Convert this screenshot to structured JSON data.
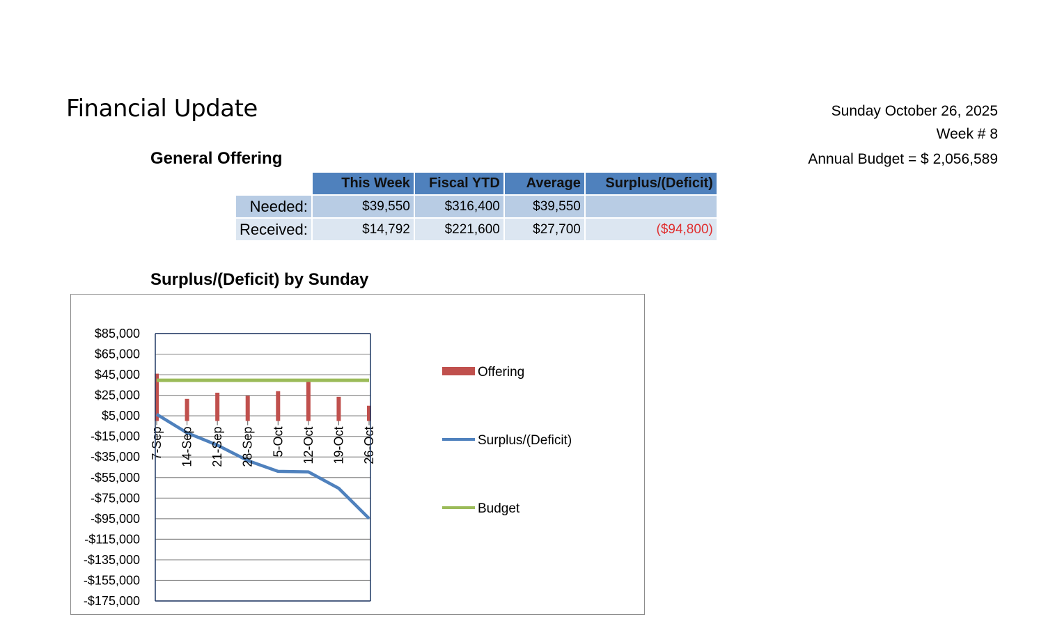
{
  "header": {
    "title": "Financial Update",
    "date": "Sunday October 26, 2025",
    "week": "Week # 8",
    "annual_budget": "Annual Budget = $ 2,056,589"
  },
  "offering": {
    "title": "General Offering",
    "columns": [
      "This Week",
      "Fiscal YTD",
      "Average",
      "Surplus/(Deficit)"
    ],
    "rows": [
      {
        "label": "Needed:",
        "values": [
          "$39,550",
          "$316,400",
          "$39,550",
          ""
        ]
      },
      {
        "label": "Received:",
        "values": [
          "$14,792",
          "$221,600",
          "$27,700",
          "($94,800)"
        ]
      }
    ]
  },
  "chart_title": "Surplus/(Deficit) by Sunday",
  "colors": {
    "offering": "#c0504d",
    "surplus": "#4f81bd",
    "budget": "#9bbb59",
    "negative": "#e03030",
    "header": "#4f81bd"
  },
  "chart_data": {
    "type": "bar",
    "title": "Surplus/(Deficit) by Sunday",
    "categories": [
      "7-Sep",
      "14-Sep",
      "21-Sep",
      "28-Sep",
      "5-Oct",
      "12-Oct",
      "19-Oct",
      "26-Oct"
    ],
    "series": [
      {
        "name": "Offering",
        "type": "bar",
        "values": [
          46000,
          21500,
          27500,
          24500,
          29000,
          39500,
          23500,
          14792
        ]
      },
      {
        "name": "Surplus/(Deficit)",
        "type": "line",
        "values": [
          6500,
          -11500,
          -23500,
          -38500,
          -49000,
          -49500,
          -65500,
          -94800
        ]
      },
      {
        "name": "Budget",
        "type": "line",
        "values": [
          39550,
          39550,
          39550,
          39550,
          39550,
          39550,
          39550,
          39550
        ]
      }
    ],
    "y_ticks": [
      "$85,000",
      "$65,000",
      "$45,000",
      "$25,000",
      "$5,000",
      "-$15,000",
      "-$35,000",
      "-$55,000",
      "-$75,000",
      "-$95,000",
      "-$115,000",
      "-$135,000",
      "-$155,000",
      "-$175,000"
    ],
    "ylim": [
      -175000,
      85000
    ],
    "ystep": 20000,
    "grid": true,
    "legend": "right"
  }
}
